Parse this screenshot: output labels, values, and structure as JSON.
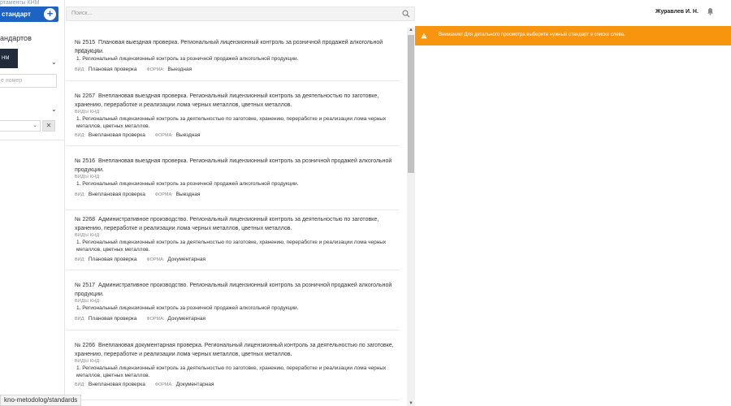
{
  "sidebar": {
    "breadcrumb": "ртаменты КНМ",
    "add_button": "стандарт",
    "section_title": "андартов",
    "dark_tile": "НМ",
    "number_placeholder": "е номер"
  },
  "search": {
    "placeholder": "Поиск..."
  },
  "header": {
    "user": "Журавлев И. Н."
  },
  "alert": {
    "message": "Внимание! Для детального просмотра выберите нужный стандарт в списке слева."
  },
  "labels": {
    "kinds": "ВИДЫ КНД:",
    "type": "ВИД:",
    "form": "ФОРМА:"
  },
  "items": [
    {
      "number": "№ 2515",
      "title": "Плановая выездная проверка. Региональный лицензионный контроль за розничной продажей алкогольной продукции.",
      "kind": "1. Региональный лицензионный контроль за розничной продажей алкогольной продукции.",
      "type": "Плановая проверка",
      "form": "Выездная"
    },
    {
      "number": "№ 2267",
      "title": "Внеплановая выездная проверка. Региональный лицензионный контроль за деятельностью по заготовке, хранению, переработке и реализации лома черных металлов, цветных металлов.",
      "kind": "1. Региональный лицензионный контроль за деятельностью по заготовке, хранению, переработке и реализации лома черных металлов, цветных металлов.",
      "type": "Внеплановая проверка",
      "form": "Выездная"
    },
    {
      "number": "№ 2516",
      "title": "Внеплановая выездная проверка. Региональный лицензионный контроль за розничной продажей алкогольной продукции.",
      "kind": "1. Региональный лицензионный контроль за розничной продажей алкогольной продукции.",
      "type": "Внеплановая проверка",
      "form": "Выездная"
    },
    {
      "number": "№ 2268",
      "title": "Административное производство. Региональный лицензионный контроль за деятельностью по заготовке, хранению, переработке и реализации лома черных металлов, цветных металлов.",
      "kind": "1. Региональный лицензионный контроль за деятельностью по заготовке, хранению, переработке и реализации лома черных металлов, цветных металлов.",
      "type": "Плановая проверка",
      "form": "Документарная"
    },
    {
      "number": "№ 2517",
      "title": "Административное производство. Региональный лицензионный контроль за розничной продажей алкогольной продукции.",
      "kind": "1. Региональный лицензионный контроль за розничной продажей алкогольной продукции.",
      "type": "Плановая проверка",
      "form": "Документарная"
    },
    {
      "number": "№ 2266",
      "title": "Внеплановая документарная проверка. Региональный лицензионный контроль за деятельностью по заготовке, хранению, переработке и реализации лома черных металлов, цветных металлов.",
      "kind": "1. Региональный лицензионный контроль за деятельностью по заготовке, хранению, переработке и реализации лома черных металлов, цветных металлов.",
      "type": "Внеплановая проверка",
      "form": "Документарная"
    }
  ],
  "status_url": "kno-metodolog/standards",
  "colors": {
    "accent": "#1e62c4",
    "alert": "#f7950f",
    "dark_tile": "#222b3a"
  }
}
